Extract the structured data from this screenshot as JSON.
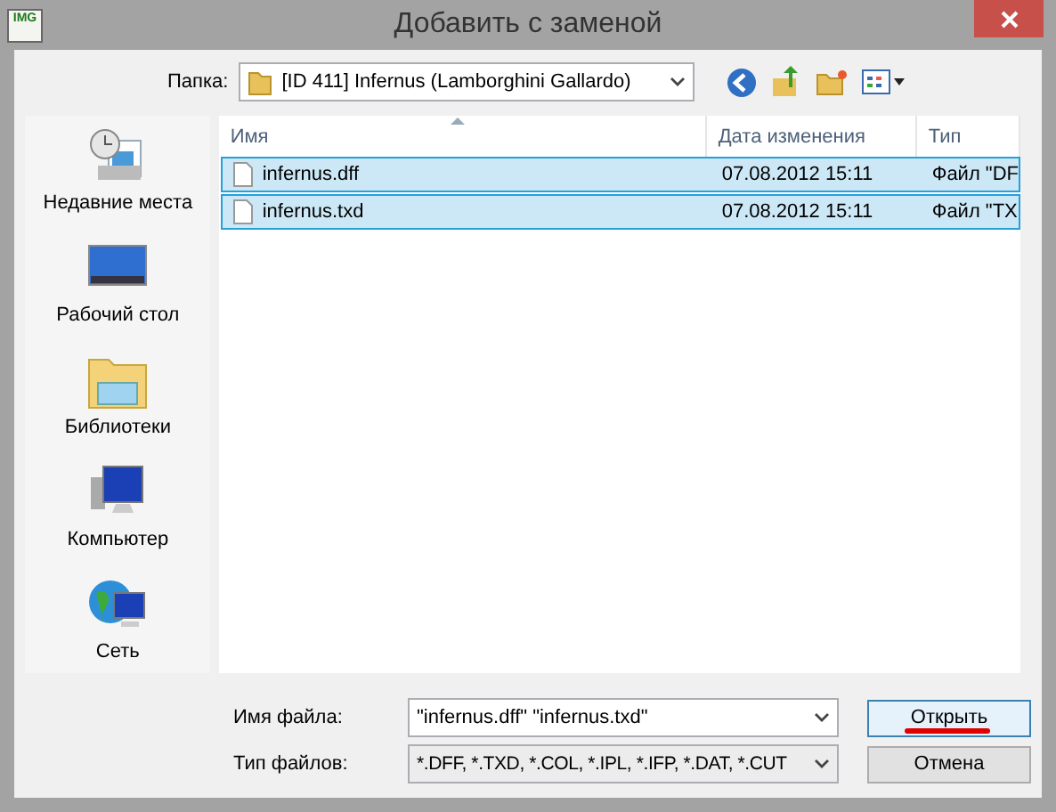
{
  "window": {
    "title": "Добавить с заменой",
    "app_icon": "IMG"
  },
  "folder": {
    "label": "Папка:",
    "value": "[ID 411] Infernus (Lamborghini Gallardo)"
  },
  "places": [
    {
      "label": "Недавние места",
      "kind": "recent"
    },
    {
      "label": "Рабочий стол",
      "kind": "desktop"
    },
    {
      "label": "Библиотеки",
      "kind": "libraries"
    },
    {
      "label": "Компьютер",
      "kind": "computer"
    },
    {
      "label": "Сеть",
      "kind": "network"
    }
  ],
  "table": {
    "columns": [
      "Имя",
      "Дата изменения",
      "Тип"
    ],
    "rows": [
      {
        "name": "infernus.dff",
        "date": "07.08.2012 15:11",
        "type": "Файл \"DF",
        "selected": true
      },
      {
        "name": "infernus.txd",
        "date": "07.08.2012 15:11",
        "type": "Файл \"TX",
        "selected": true
      }
    ]
  },
  "file_name": {
    "label": "Имя файла:",
    "value": "\"infernus.dff\" \"infernus.txd\""
  },
  "file_type": {
    "label": "Тип файлов:",
    "value": "*.DFF, *.TXD, *.COL, *.IPL, *.IFP, *.DAT, *.CUT"
  },
  "buttons": [
    {
      "label": "Открыть",
      "default": true
    },
    {
      "label": "Отмена",
      "default": false
    }
  ]
}
